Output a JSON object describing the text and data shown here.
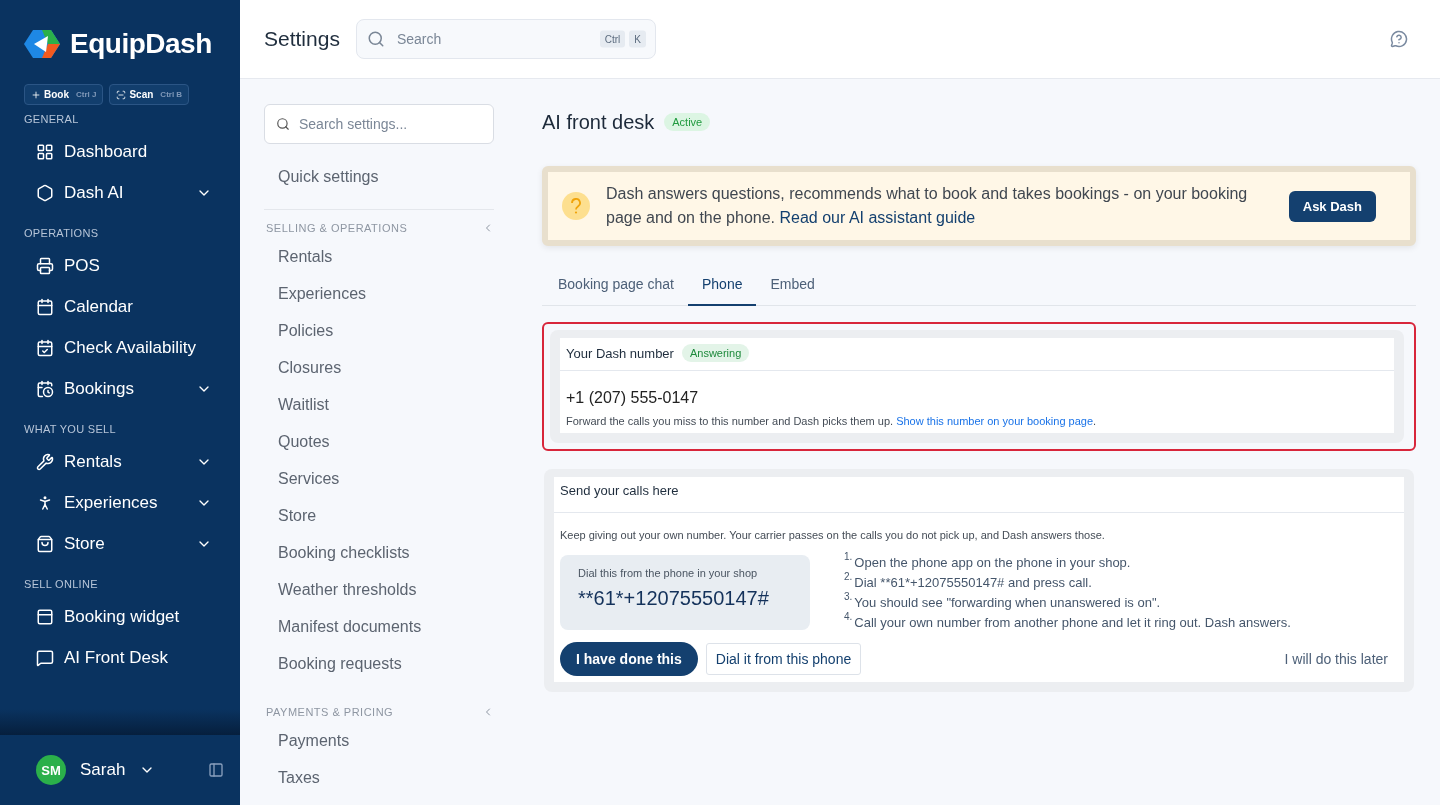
{
  "brand": {
    "name": "EquipDash"
  },
  "quick_actions": [
    {
      "label": "Book",
      "shortcut": "Ctrl J"
    },
    {
      "label": "Scan",
      "shortcut": "Ctrl B"
    }
  ],
  "sidebar": {
    "sections": [
      {
        "title": "GENERAL",
        "items": [
          {
            "label": "Dashboard",
            "expandable": false
          },
          {
            "label": "Dash AI",
            "expandable": true
          }
        ]
      },
      {
        "title": "OPERATIONS",
        "items": [
          {
            "label": "POS",
            "expandable": false
          },
          {
            "label": "Calendar",
            "expandable": false
          },
          {
            "label": "Check Availability",
            "expandable": false
          },
          {
            "label": "Bookings",
            "expandable": true
          }
        ]
      },
      {
        "title": "WHAT YOU SELL",
        "items": [
          {
            "label": "Rentals",
            "expandable": true
          },
          {
            "label": "Experiences",
            "expandable": true
          },
          {
            "label": "Store",
            "expandable": true
          }
        ]
      },
      {
        "title": "SELL ONLINE",
        "items": [
          {
            "label": "Booking widget",
            "expandable": false
          },
          {
            "label": "AI Front Desk",
            "expandable": false
          }
        ]
      }
    ]
  },
  "user": {
    "initials": "SM",
    "name": "Sarah"
  },
  "header": {
    "title": "Settings",
    "search": {
      "placeholder": "Search",
      "keys": [
        "Ctrl",
        "K"
      ]
    }
  },
  "settings_nav": {
    "search": {
      "placeholder": "Search settings..."
    },
    "top_item": "Quick settings",
    "sections": [
      {
        "title": "SELLING & OPERATIONS",
        "items": [
          "Rentals",
          "Experiences",
          "Policies",
          "Closures",
          "Waitlist",
          "Quotes",
          "Services",
          "Store",
          "Booking checklists",
          "Weather thresholds",
          "Manifest documents",
          "Booking requests"
        ]
      },
      {
        "title": "PAYMENTS & PRICING",
        "items": [
          "Payments",
          "Taxes"
        ]
      }
    ]
  },
  "page": {
    "title": "AI front desk",
    "status": "Active",
    "banner": {
      "text": "Dash answers questions, recommends what to book and takes bookings - on your booking page and on the phone.",
      "link": "Read our AI assistant guide",
      "button": "Ask Dash"
    },
    "tabs": [
      {
        "label": "Booking page chat",
        "selected": false
      },
      {
        "label": "Phone",
        "selected": true
      },
      {
        "label": "Embed",
        "selected": false
      }
    ],
    "number_card": {
      "title": "Your Dash number",
      "status": "Answering",
      "highlighted": true,
      "number": "+1 (207) 555-0147",
      "note": "Forward the calls you miss to this number and Dash picks them up.",
      "link": "Show this number on your booking page",
      "after_link": "."
    },
    "forward_card": {
      "title": "Send your calls here",
      "intro": "Keep giving out your own number. Your carrier passes on the calls you do not pick up, and Dash answers those.",
      "dial_box": {
        "caption": "Dial this from the phone in your shop",
        "code": "**61*+12075550147#"
      },
      "steps": [
        {
          "number": "1.",
          "text": "Open the phone app on the phone in your shop."
        },
        {
          "number": "2.",
          "text": "Dial **61*+12075550147# and press call."
        },
        {
          "number": "3.",
          "text": "You should see \"forwarding when unanswered is on\"."
        },
        {
          "number": "4.",
          "text": "Call your own number from another phone and let it ring out. Dash answers."
        }
      ],
      "primary_button": "I have done this",
      "secondary_button": "Dial it from this phone",
      "later_link": "I will do this later"
    }
  }
}
